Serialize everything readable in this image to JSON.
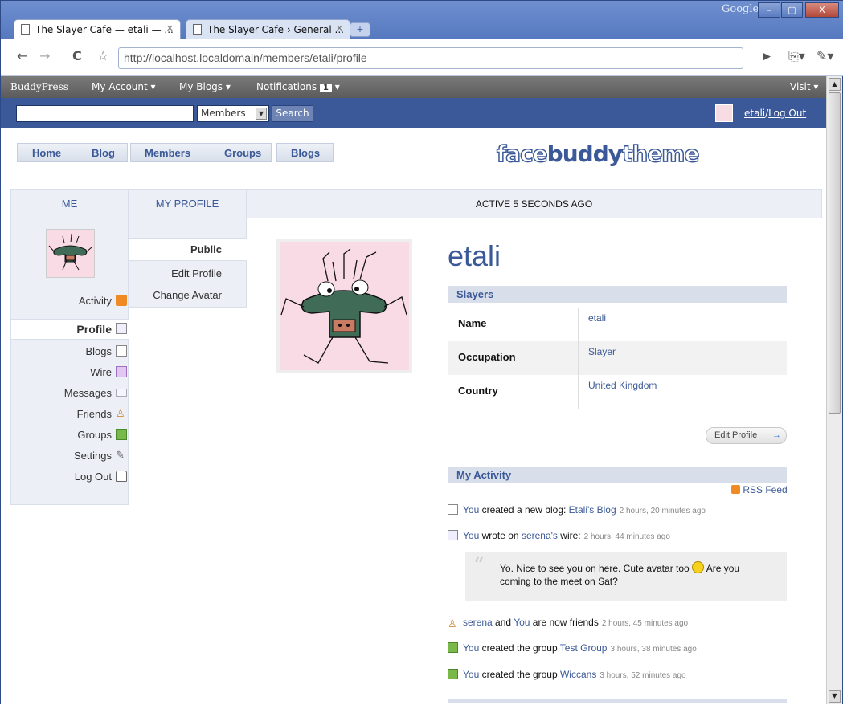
{
  "browser": {
    "brand": "Google",
    "tabs": [
      {
        "title": "The Slayer Cafe — etali — ...",
        "active": true
      },
      {
        "title": "The Slayer Cafe › General ...",
        "active": false
      }
    ],
    "new_tab_symbol": "+",
    "url_host": "http://localhost.localdomain",
    "url_path": "/members/etali/profile",
    "window_controls": {
      "minimize": "–",
      "maximize": "▢",
      "close": "X"
    }
  },
  "adminbar": {
    "brand": "BuddyPress",
    "my_account": "My Account",
    "my_blogs": "My Blogs",
    "notifications": "Notifications",
    "notifications_count": "1",
    "visit": "Visit"
  },
  "searchbar": {
    "search_value": "",
    "scope_selected": "Members",
    "search_button": "Search",
    "username": "etali",
    "separator": "/",
    "logout": "Log Out"
  },
  "main_nav": {
    "home": "Home",
    "blog": "Blog",
    "members": "Members",
    "groups": "Groups",
    "blogs": "Blogs"
  },
  "logo": {
    "face": "face",
    "buddy": "buddy",
    "theme": "theme"
  },
  "columns": {
    "me": "ME",
    "my_profile": "MY PROFILE",
    "activity_status": "ACTIVE 5 SECONDS AGO"
  },
  "left_nav": {
    "activity": "Activity",
    "profile": "Profile",
    "blogs": "Blogs",
    "wire": "Wire",
    "messages": "Messages",
    "friends": "Friends",
    "groups": "Groups",
    "settings": "Settings",
    "logout": "Log Out"
  },
  "sub_nav": {
    "public": "Public",
    "edit_profile": "Edit Profile",
    "change_avatar": "Change Avatar"
  },
  "profile": {
    "username": "etali",
    "section_title": "Slayers",
    "fields": [
      {
        "label": "Name",
        "value": "etali"
      },
      {
        "label": "Occupation",
        "value": "Slayer"
      },
      {
        "label": "Country",
        "value": "United Kingdom"
      }
    ],
    "edit_button": "Edit Profile",
    "edit_arrow": "→"
  },
  "activity": {
    "title": "My Activity",
    "rss_label": "RSS Feed",
    "items": [
      {
        "actor": "You",
        "text": " created a new blog: ",
        "target": "Etali's Blog",
        "time": "2 hours, 20 minutes ago"
      },
      {
        "actor": "You",
        "text": " wrote on ",
        "target": "serena's",
        "suffix": " wire:",
        "time": "2 hours, 44 minutes ago"
      },
      {
        "actor": "serena",
        "text": " and ",
        "target": "You",
        "suffix": " are now friends",
        "time": "2 hours, 45 minutes ago"
      },
      {
        "actor": "You",
        "text": " created the group ",
        "target": "Test Group",
        "time": "3 hours, 38 minutes ago"
      },
      {
        "actor": "You",
        "text": " created the group ",
        "target": "Wiccans",
        "time": "3 hours, 52 minutes ago"
      }
    ],
    "quote_line1": "Yo. Nice to see you on here. Cute avatar too",
    "quote_line1_end": " Are you",
    "quote_line2": "coming to the meet on Sat?",
    "quote_mark": "“"
  },
  "colors": {
    "brand_blue": "#3b5998",
    "nav_bg": "#eceff5",
    "rss_orange": "#f08a24"
  }
}
